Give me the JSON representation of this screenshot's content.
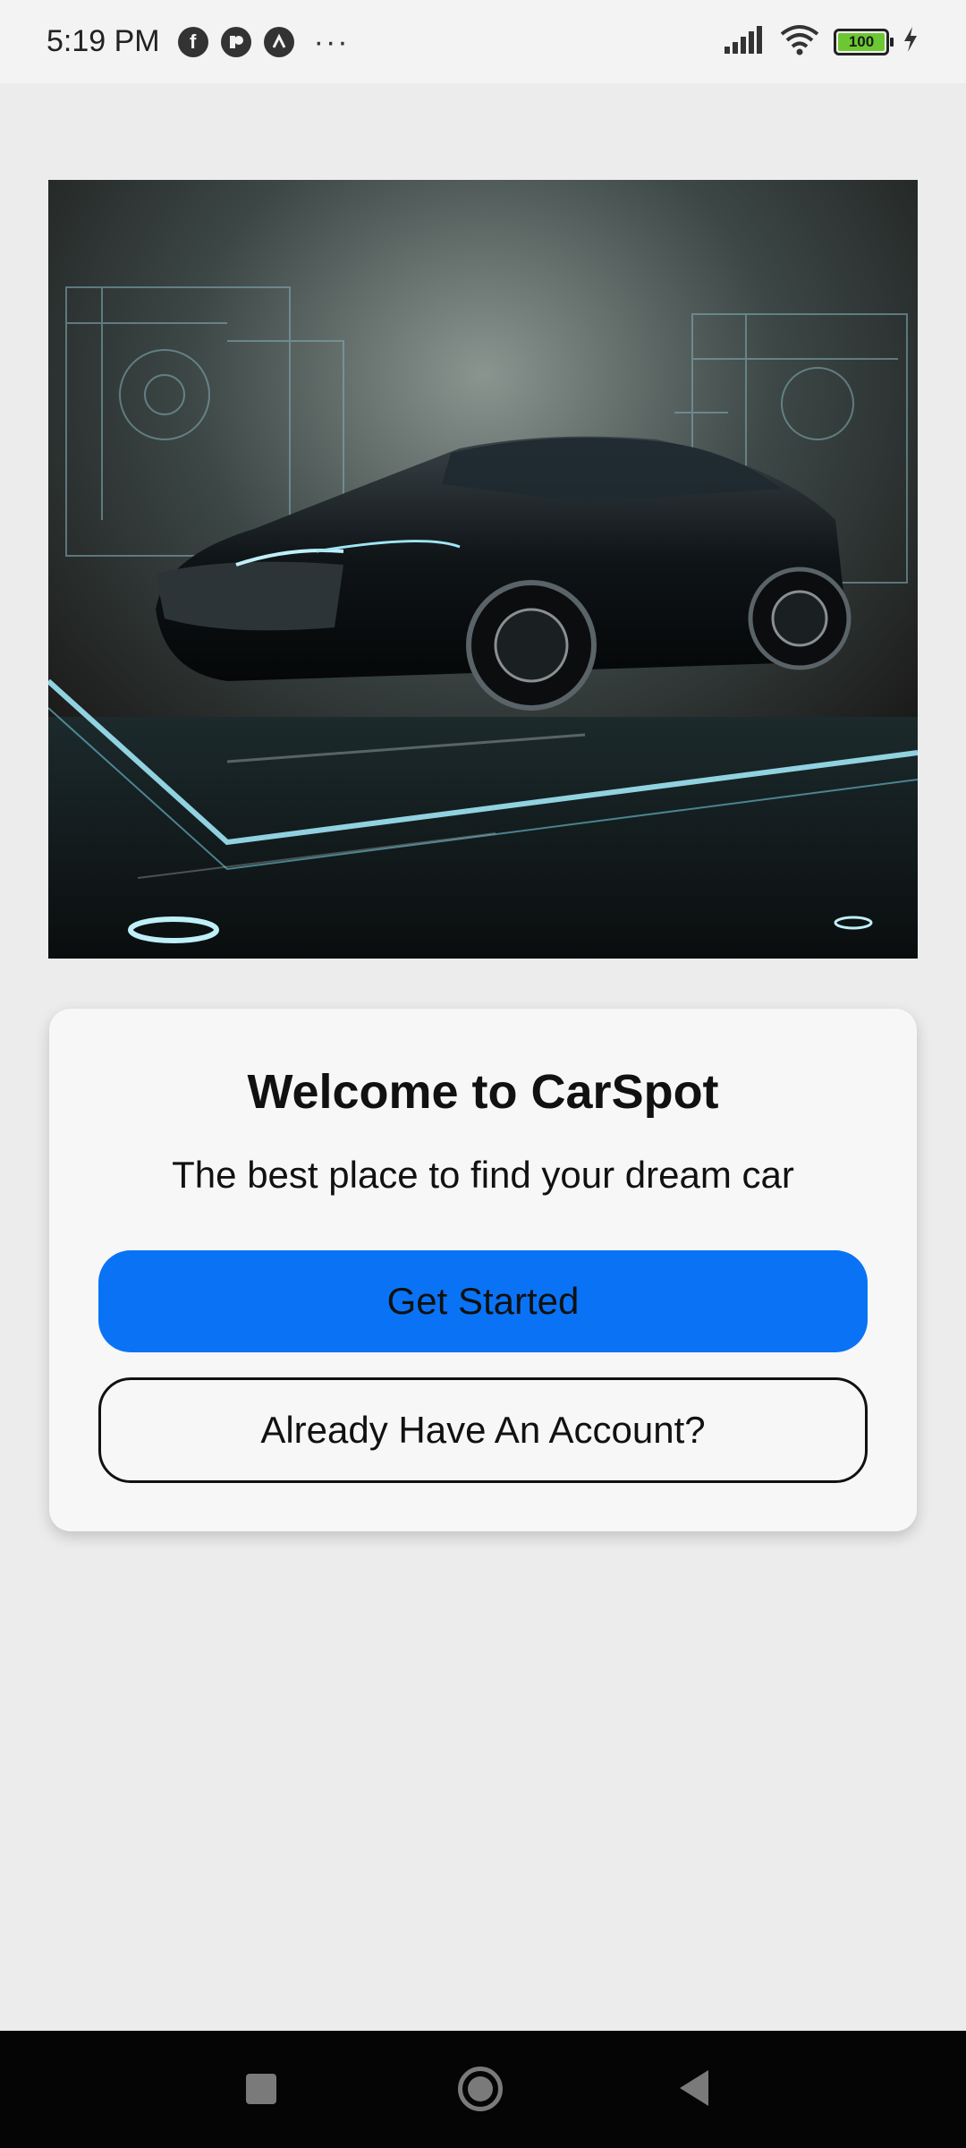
{
  "status_bar": {
    "time": "5:19 PM",
    "app_icons": [
      "facebook-icon",
      "app-icon",
      "arc-icon"
    ],
    "more": "···",
    "battery_level": "100",
    "indicators": [
      "signal-icon",
      "wifi-icon",
      "battery-icon",
      "charging-icon"
    ]
  },
  "hero": {
    "alt_icon": "car-hero-image"
  },
  "card": {
    "title": "Welcome to CarSpot",
    "subtitle": "The best place to find your dream car",
    "primary_button": "Get Started",
    "secondary_button": "Already Have An Account?"
  },
  "colors": {
    "primary": "#0a73f5",
    "background": "#ececec",
    "card": "#f7f7f7"
  },
  "nav_bar": {
    "items": [
      "recents-icon",
      "home-icon",
      "back-icon"
    ]
  }
}
